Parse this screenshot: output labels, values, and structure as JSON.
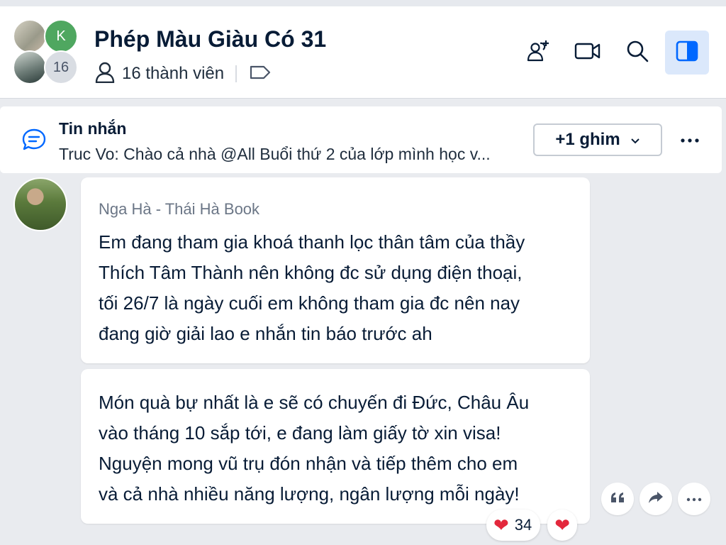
{
  "header": {
    "title": "Phép Màu Giàu Có 31",
    "members": "16 thành viên",
    "avatar_letter": "K",
    "avatar_count": "16",
    "icons": [
      "add-member-icon",
      "video-call-icon",
      "search-icon",
      "sidebar-toggle-icon"
    ],
    "active_color": "#dbe8fb"
  },
  "pinned": {
    "title": "Tin nhắn",
    "preview": "Truc Vo: Chào cả nhà @All Buổi thứ 2 của lớp mình học v...",
    "pin_button": "+1 ghim"
  },
  "messages": [
    {
      "sender": "Nga Hà - Thái Hà Book",
      "lines": [
        "Em đang tham gia khoá thanh lọc thân tâm của thầy",
        "Thích Tâm Thành nên không đc sử dụng điện thoại,",
        "tối 26/7 là ngày cuối em không tham gia đc nên nay",
        "đang giờ giải lao e nhắn tin báo trước ah"
      ]
    },
    {
      "lines": [
        "Món quà bự nhất là e sẽ có chuyến đi Đức, Châu Âu",
        "vào tháng 10 sắp tới, e đang làm giấy tờ xin visa!",
        "Nguyện mong vũ trụ đón nhận và tiếp thêm cho em",
        "và cả nhà nhiều năng lượng, ngân lượng mỗi ngày!"
      ]
    }
  ],
  "reactions": {
    "heart_count": "34"
  },
  "colors": {
    "background": "#e9ebef",
    "text": "#081c36",
    "heart": "#e3283c",
    "accent": "#0068ff"
  }
}
